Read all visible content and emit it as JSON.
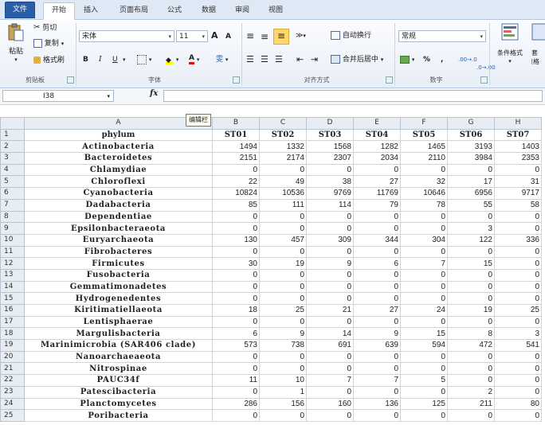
{
  "ribbon_tabs": [
    "文件",
    "开始",
    "插入",
    "页面布局",
    "公式",
    "数据",
    "审阅",
    "视图"
  ],
  "clipboard": {
    "paste": "粘贴",
    "cut": "剪切",
    "copy": "复制",
    "format_painter": "格式刷",
    "label": "剪贴板"
  },
  "font": {
    "name": "宋体",
    "size": "11",
    "bold": "B",
    "italic": "I",
    "underline": "U",
    "grow": "A",
    "shrink": "A",
    "wen": "雯",
    "label": "字体"
  },
  "alignment": {
    "wrap": "自动换行",
    "merge": "合并后居中",
    "label": "对齐方式"
  },
  "number": {
    "format": "常规",
    "percent": "%",
    "comma": ",",
    "inc_dec": ".00→.0",
    "dec_dec": ".0→.00",
    "label": "数字"
  },
  "styles": {
    "conditional": "条件格式",
    "table_fmt": "套",
    "table_fmt2": "表格"
  },
  "formula_bar": {
    "cell_ref": "I38",
    "fx": "fx",
    "tooltip": "编辑栏"
  },
  "columns": [
    "A",
    "B",
    "C",
    "D",
    "E",
    "F",
    "G",
    "H"
  ],
  "header_row": {
    "row": "1",
    "cells": [
      "phylum",
      "ST01",
      "ST02",
      "ST03",
      "ST04",
      "ST05",
      "ST06",
      "ST07"
    ]
  },
  "rows": [
    {
      "row": "2",
      "name": "Actinobacteria",
      "vals": [
        "1494",
        "1332",
        "1568",
        "1282",
        "1465",
        "3193",
        "1403"
      ]
    },
    {
      "row": "3",
      "name": "Bacteroidetes",
      "vals": [
        "2151",
        "2174",
        "2307",
        "2034",
        "2110",
        "3984",
        "2353"
      ]
    },
    {
      "row": "4",
      "name": "Chlamydiae",
      "vals": [
        "0",
        "0",
        "0",
        "0",
        "0",
        "0",
        "0"
      ]
    },
    {
      "row": "5",
      "name": "Chloroflexi",
      "vals": [
        "22",
        "49",
        "38",
        "27",
        "32",
        "17",
        "31"
      ]
    },
    {
      "row": "6",
      "name": "Cyanobacteria",
      "vals": [
        "10824",
        "10536",
        "9769",
        "11769",
        "10646",
        "6956",
        "9717"
      ]
    },
    {
      "row": "7",
      "name": "Dadabacteria",
      "vals": [
        "85",
        "111",
        "114",
        "79",
        "78",
        "55",
        "58"
      ]
    },
    {
      "row": "8",
      "name": "Dependentiae",
      "vals": [
        "0",
        "0",
        "0",
        "0",
        "0",
        "0",
        "0"
      ]
    },
    {
      "row": "9",
      "name": "Epsilonbacteraeota",
      "vals": [
        "0",
        "0",
        "0",
        "0",
        "0",
        "3",
        "0"
      ]
    },
    {
      "row": "10",
      "name": "Euryarchaeota",
      "vals": [
        "130",
        "457",
        "309",
        "344",
        "304",
        "122",
        "336"
      ]
    },
    {
      "row": "11",
      "name": "Fibrobacteres",
      "vals": [
        "0",
        "0",
        "0",
        "0",
        "0",
        "0",
        "0"
      ]
    },
    {
      "row": "12",
      "name": "Firmicutes",
      "vals": [
        "30",
        "19",
        "9",
        "6",
        "7",
        "15",
        "0"
      ]
    },
    {
      "row": "13",
      "name": "Fusobacteria",
      "vals": [
        "0",
        "0",
        "0",
        "0",
        "0",
        "0",
        "0"
      ]
    },
    {
      "row": "14",
      "name": "Gemmatimonadetes",
      "vals": [
        "0",
        "0",
        "0",
        "0",
        "0",
        "0",
        "0"
      ]
    },
    {
      "row": "15",
      "name": "Hydrogenedentes",
      "vals": [
        "0",
        "0",
        "0",
        "0",
        "0",
        "0",
        "0"
      ]
    },
    {
      "row": "16",
      "name": "Kiritimatiellaeota",
      "vals": [
        "18",
        "25",
        "21",
        "27",
        "24",
        "19",
        "25"
      ]
    },
    {
      "row": "17",
      "name": "Lentisphaerae",
      "vals": [
        "0",
        "0",
        "0",
        "0",
        "0",
        "0",
        "0"
      ]
    },
    {
      "row": "18",
      "name": "Margulisbacteria",
      "vals": [
        "6",
        "9",
        "14",
        "9",
        "15",
        "8",
        "3"
      ]
    },
    {
      "row": "19",
      "name": "Marinimicrobia (SAR406 clade)",
      "vals": [
        "573",
        "738",
        "691",
        "639",
        "594",
        "472",
        "541"
      ]
    },
    {
      "row": "20",
      "name": "Nanoarchaeaeota",
      "vals": [
        "0",
        "0",
        "0",
        "0",
        "0",
        "0",
        "0"
      ]
    },
    {
      "row": "21",
      "name": "Nitrospinae",
      "vals": [
        "0",
        "0",
        "0",
        "0",
        "0",
        "0",
        "0"
      ]
    },
    {
      "row": "22",
      "name": "PAUC34f",
      "vals": [
        "11",
        "10",
        "7",
        "7",
        "5",
        "0",
        "0"
      ]
    },
    {
      "row": "23",
      "name": "Patescibacteria",
      "vals": [
        "0",
        "1",
        "0",
        "0",
        "0",
        "2",
        "0"
      ]
    },
    {
      "row": "24",
      "name": "Planctomycetes",
      "vals": [
        "286",
        "156",
        "160",
        "136",
        "125",
        "211",
        "80"
      ]
    },
    {
      "row": "25",
      "name": "Poribacteria",
      "vals": [
        "0",
        "0",
        "0",
        "0",
        "0",
        "0",
        "0"
      ]
    }
  ]
}
